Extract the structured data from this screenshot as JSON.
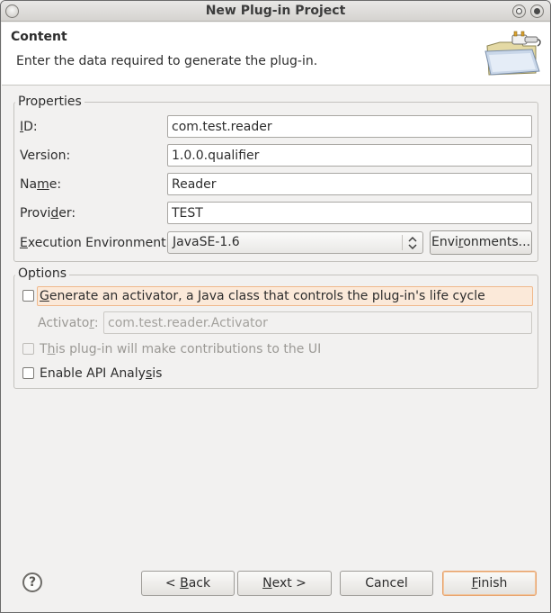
{
  "window": {
    "title": "New Plug-in Project"
  },
  "header": {
    "title": "Content",
    "description": "Enter the data required to generate the plug-in."
  },
  "properties": {
    "legend": "Properties",
    "id_label_u": "I",
    "id_label_rest": "D:",
    "id_value": "com.test.reader",
    "version_label": "Version:",
    "version_value": "1.0.0.qualifier",
    "name_label_pre": "Na",
    "name_label_u": "m",
    "name_label_post": "e:",
    "name_value": "Reader",
    "provider_label_pre": "Provi",
    "provider_label_u": "d",
    "provider_label_post": "er:",
    "provider_value": "TEST",
    "exec_env_label_u": "E",
    "exec_env_label_rest": "xecution Environment:",
    "exec_env_value": "JavaSE-1.6",
    "environments_button_pre": "Envi",
    "environments_button_u": "r",
    "environments_button_post": "onments..."
  },
  "options": {
    "legend": "Options",
    "activator_checkbox_u": "G",
    "activator_checkbox_rest": "enerate an activator, a Java class that controls the plug-in's life cycle",
    "activator_checked": false,
    "activator_label_pre": "Activato",
    "activator_label_u": "r",
    "activator_label_post": ":",
    "activator_value": "com.test.reader.Activator",
    "ui_contrib_pre": "T",
    "ui_contrib_u": "h",
    "ui_contrib_post": "is plug-in will make contributions to the UI",
    "ui_contrib_checked": false,
    "api_analysis_pre": "Enable API Analy",
    "api_analysis_u": "s",
    "api_analysis_post": "is",
    "api_analysis_checked": false
  },
  "footer": {
    "help": "?",
    "back_pre": "< ",
    "back_u": "B",
    "back_post": "ack",
    "next_u": "N",
    "next_post": "ext >",
    "cancel": "Cancel",
    "finish_u": "F",
    "finish_post": "inish"
  },
  "icons": {
    "window_menu": "window-menu-icon",
    "minimize": "minimize-icon",
    "maximize": "maximize-icon",
    "wizard_banner": "plug-in-folder-icon",
    "combo_arrows": "up-down-arrows-icon",
    "help": "help-icon"
  },
  "colors": {
    "accent": "#f0b98c",
    "header_bg": "#ffffff",
    "window_bg": "#f2f1f0"
  }
}
